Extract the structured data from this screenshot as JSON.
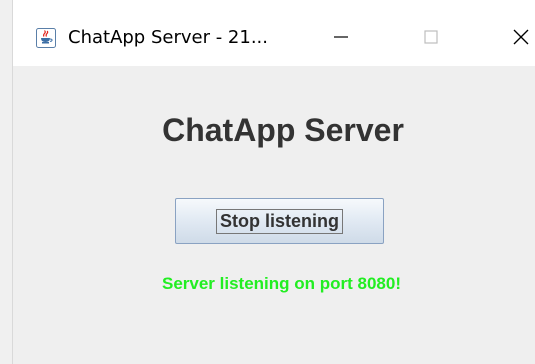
{
  "window": {
    "title": "ChatApp Server - 21...",
    "app_icon": "java-cup-icon",
    "controls": {
      "minimize_icon": "minimize-icon",
      "maximize_icon": "maximize-icon",
      "close_icon": "close-icon"
    }
  },
  "main": {
    "heading": "ChatApp Server",
    "toggle_button_label": "Stop listening",
    "status_text": "Server listening on port 8080!"
  },
  "colors": {
    "status_text": "#22ee22",
    "heading_text": "#333333",
    "content_background": "#efefef",
    "button_border": "#8aa2c2"
  }
}
